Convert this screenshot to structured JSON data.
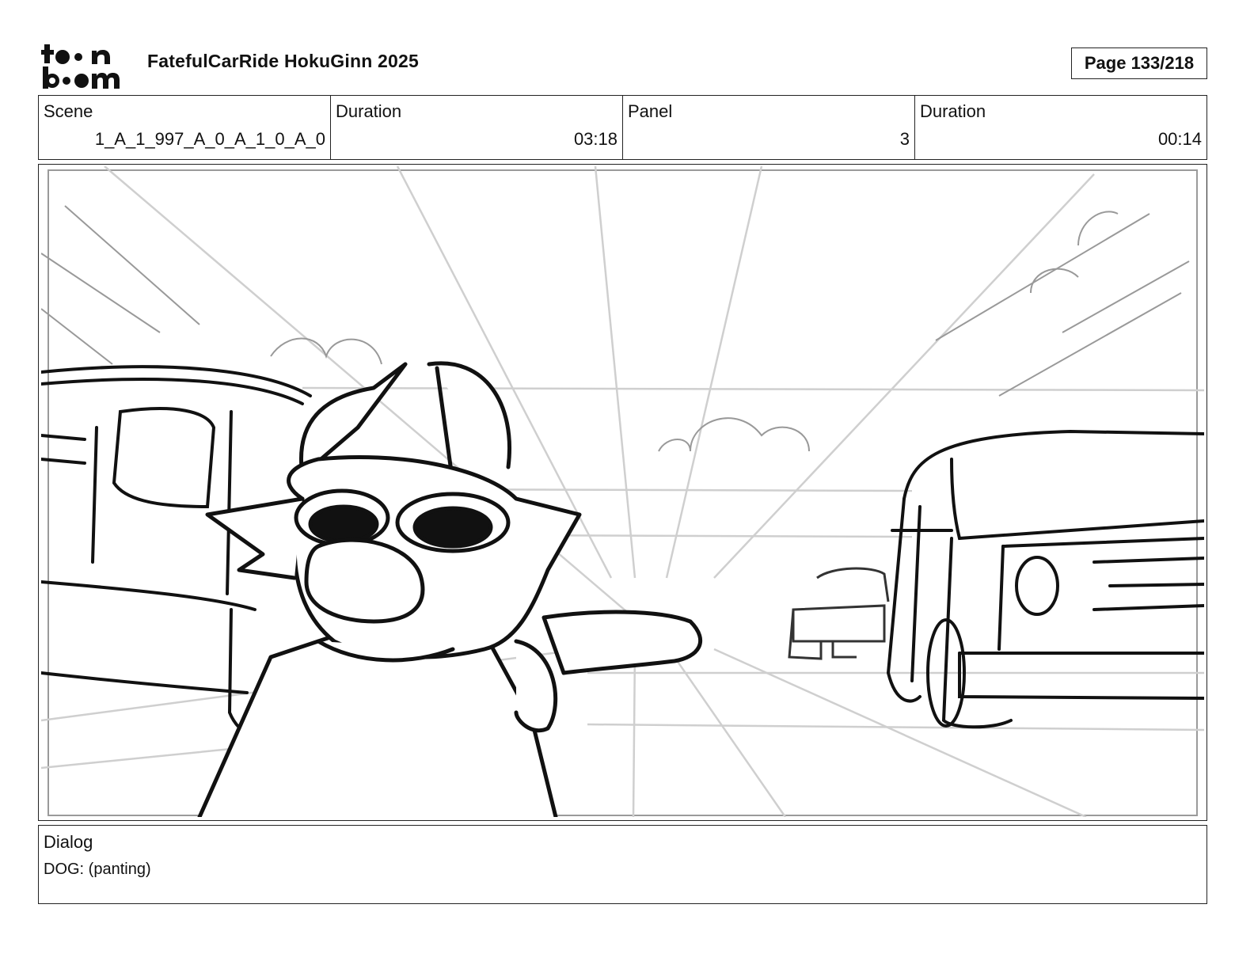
{
  "header": {
    "logo_text": "toon boom",
    "project_title": "FatefulCarRide HokuGinn 2025",
    "page_label": "Page 133/218"
  },
  "info": {
    "scene_label": "Scene",
    "scene_value": "1_A_1_997_A_0_A_1_0_A_0",
    "scene_duration_label": "Duration",
    "scene_duration_value": "03:18",
    "panel_label": "Panel",
    "panel_value": "3",
    "panel_duration_label": "Duration",
    "panel_duration_value": "00:14"
  },
  "dialog": {
    "label": "Dialog",
    "text": "DOG: (panting)"
  },
  "panel_sketch": {
    "subject": "dog-character",
    "background": "highway-with-cars"
  }
}
